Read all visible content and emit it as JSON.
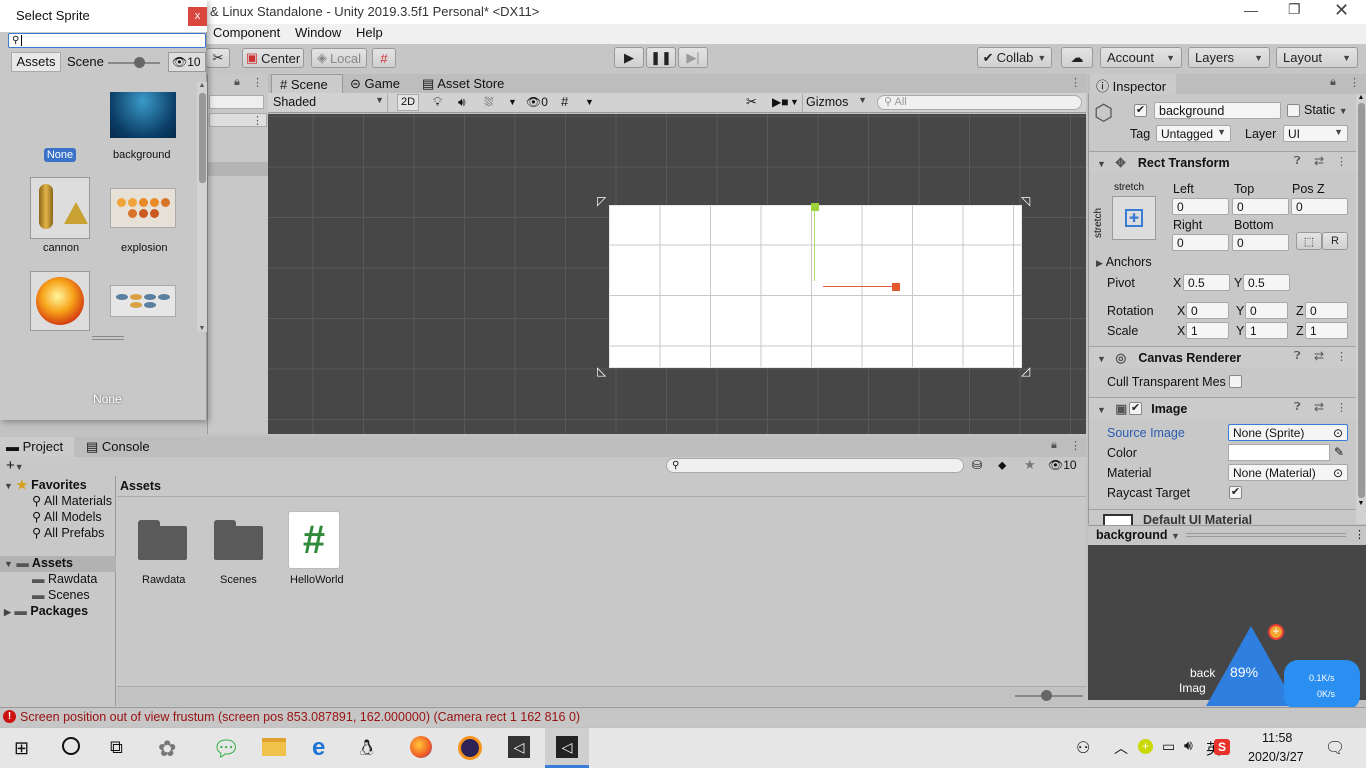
{
  "window": {
    "title": "& Linux Standalone - Unity 2019.3.5f1 Personal* <DX11>"
  },
  "menu": {
    "items": [
      "Component",
      "Window",
      "Help"
    ]
  },
  "toolbar": {
    "center": "Center",
    "local": "Local",
    "collab": "Collab",
    "account": "Account",
    "layers": "Layers",
    "layout": "Layout"
  },
  "select_sprite": {
    "title": "Select Sprite",
    "close": "x",
    "search_value": "",
    "tabs": [
      "Assets",
      "Scene"
    ],
    "hidden_count": "10",
    "items": [
      "None",
      "background",
      "cannon",
      "explosion",
      "",
      ""
    ],
    "preview_label": "None"
  },
  "scene_view": {
    "tabs": [
      "Scene",
      "Game",
      "Asset Store"
    ],
    "shading": "Shaded",
    "mode_2d": "2D",
    "hidden_count": "0",
    "gizmos": "Gizmos",
    "search_placeholder": "All"
  },
  "inspector": {
    "tab": "Inspector",
    "object_name": "background",
    "static_label": "Static",
    "tag_label": "Tag",
    "tag_value": "Untagged",
    "layer_label": "Layer",
    "layer_value": "UI",
    "rect_transform": {
      "title": "Rect Transform",
      "anchor_preset": "stretch",
      "left_label": "Left",
      "left": "0",
      "top_label": "Top",
      "top": "0",
      "posz_label": "Pos Z",
      "posz": "0",
      "right_label": "Right",
      "right": "0",
      "bottom_label": "Bottom",
      "bottom": "0",
      "anchors": "Anchors",
      "pivot": "Pivot",
      "pivot_x": "0.5",
      "pivot_y": "0.5",
      "rotation": "Rotation",
      "rot_x": "0",
      "rot_y": "0",
      "rot_z": "0",
      "scale": "Scale",
      "scale_x": "1",
      "scale_y": "1",
      "scale_z": "1",
      "r_button": "R"
    },
    "canvas_renderer": {
      "title": "Canvas Renderer",
      "cull_label": "Cull Transparent Mes"
    },
    "image": {
      "title": "Image",
      "source_image_label": "Source Image",
      "source_image": "None (Sprite)",
      "color_label": "Color",
      "material_label": "Material",
      "material": "None (Material)",
      "raycast_label": "Raycast Target"
    },
    "default_material": "Default UI Material",
    "preview_name": "background",
    "preview_text_1": "back",
    "preview_text_2": "Imag"
  },
  "project": {
    "tabs": [
      "Project",
      "Console"
    ],
    "hidden_count": "10",
    "favorites": "Favorites",
    "fav_items": [
      "All Materials",
      "All Models",
      "All Prefabs"
    ],
    "assets_root": "Assets",
    "asset_folders": [
      "Rawdata",
      "Scenes"
    ],
    "packages": "Packages",
    "breadcrumb": "Assets",
    "grid_items": [
      "Rawdata",
      "Scenes",
      "HelloWorld"
    ]
  },
  "status_bar": {
    "message": "Screen position out of view frustum (screen pos 853.087891, 162.000000) (Camera rect 1 162 816 0)",
    "error_color": "#cc1111"
  },
  "widget": {
    "percent": "89%",
    "upload": "0.1K/s",
    "download": "0K/s"
  },
  "taskbar": {
    "time": "11:58",
    "date": "2020/3/27",
    "ime": "英"
  }
}
